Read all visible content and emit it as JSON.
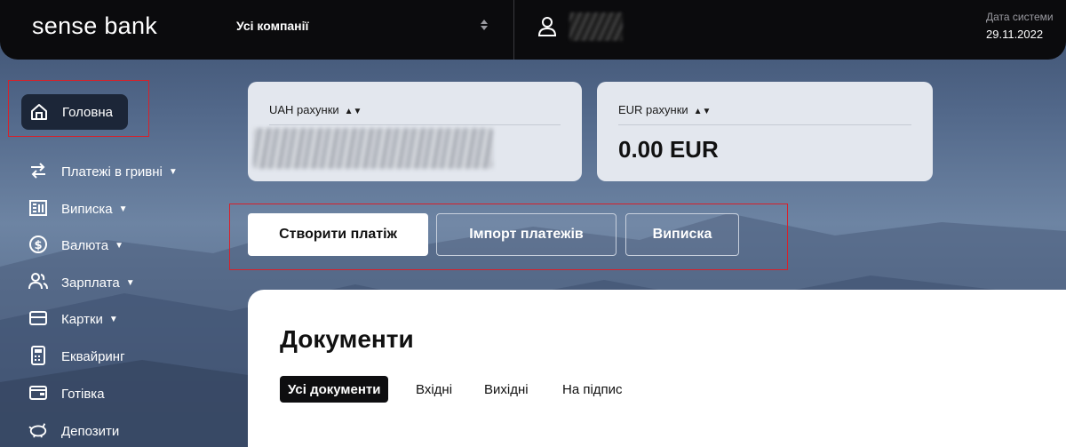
{
  "brand": {
    "logo": "sense bank"
  },
  "header": {
    "company_select": "Усі компанії",
    "system_date_label": "Дата системи",
    "system_date": "29.11.2022"
  },
  "sidebar": {
    "home": "Головна",
    "items": [
      {
        "label": "Платежі в гривні",
        "icon": "transfer-arrows-icon",
        "has_caret": true
      },
      {
        "label": "Виписка",
        "icon": "statement-icon",
        "has_caret": true
      },
      {
        "label": "Валюта",
        "icon": "dollar-coin-icon",
        "has_caret": true
      },
      {
        "label": "Зарплата",
        "icon": "people-icon",
        "has_caret": true
      },
      {
        "label": "Картки",
        "icon": "card-icon",
        "has_caret": true
      },
      {
        "label": "Еквайринг",
        "icon": "pos-terminal-icon",
        "has_caret": false
      },
      {
        "label": "Готівка",
        "icon": "wallet-icon",
        "has_caret": false
      },
      {
        "label": "Депозити",
        "icon": "piggy-bank-icon",
        "has_caret": false
      }
    ]
  },
  "accounts": {
    "uah_title": "UAH рахунки",
    "eur_title": "EUR рахунки",
    "eur_amount": "0.00 EUR"
  },
  "actions": {
    "create_payment": "Створити платіж",
    "import_payments": "Імпорт платежів",
    "statement": "Виписка"
  },
  "documents": {
    "title": "Документи",
    "tabs": [
      "Усі документи",
      "Вхідні",
      "Вихідні",
      "На підпис"
    ]
  },
  "colors": {
    "header_bg": "#0b0b0d",
    "highlight": "#d8202a",
    "active_tab": "#0e0e10",
    "card_bg": "#e3e7ee"
  }
}
